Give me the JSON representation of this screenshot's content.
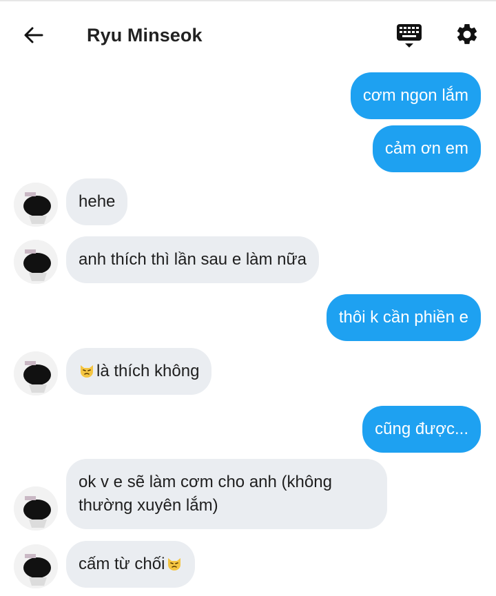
{
  "header": {
    "title": "Ryu Minseok",
    "icons": {
      "back": "back-arrow-icon",
      "keyboard": "keyboard-icon",
      "settings": "gear-icon"
    }
  },
  "colors": {
    "outgoing": "#1ea1f1",
    "incoming": "#eaedf1",
    "text": "#222222"
  },
  "messages": [
    {
      "from": "me",
      "text": "cơm ngon lắm"
    },
    {
      "from": "me",
      "text": "cảm ơn em"
    },
    {
      "from": "them",
      "text": "hehe"
    },
    {
      "from": "them",
      "text": "anh thích thì lần sau e làm nữa"
    },
    {
      "from": "me",
      "text": "thôi k cần phiền e"
    },
    {
      "from": "them",
      "text": "là thích không",
      "emoji": "pouting-cat-emoji"
    },
    {
      "from": "me",
      "text": "cũng được..."
    },
    {
      "from": "them",
      "text": "ok v e sẽ làm cơm cho anh (không thường xuyên lắm)"
    },
    {
      "from": "them",
      "text": "cấm từ chối",
      "emoji": "pouting-cat-emoji"
    }
  ]
}
